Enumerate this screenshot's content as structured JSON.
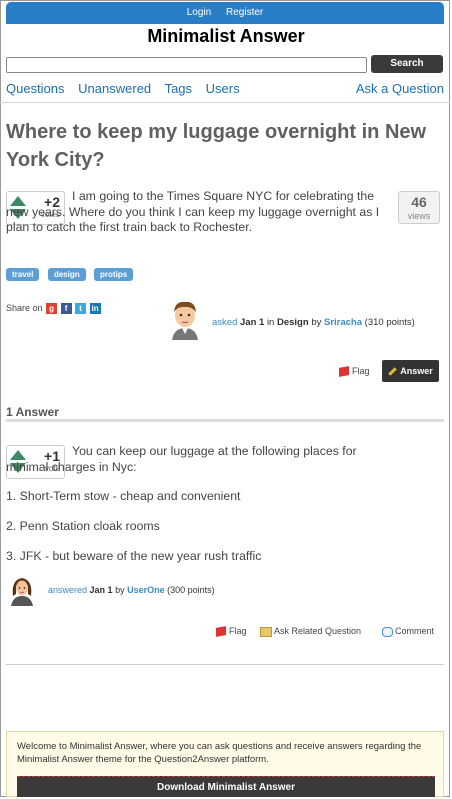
{
  "header": {
    "login": "Login",
    "register": "Register",
    "site_title": "Minimalist Answer",
    "search_button": "Search",
    "search_placeholder": ""
  },
  "nav": {
    "questions": "Questions",
    "unanswered": "Unanswered",
    "tags": "Tags",
    "users": "Users",
    "ask": "Ask a Question"
  },
  "question": {
    "title": "Where to keep my luggage overnight in New York City?",
    "votes": "+2",
    "votes_label": "votes",
    "views": "46",
    "views_label": "views",
    "body": "I am going to the Times Square NYC for celebrating the new years. Where do you think I can keep my luggage overnight as I plan to catch the first train back to Rochester.",
    "tags": [
      "travel",
      "design",
      "protips"
    ],
    "share_label": "Share on",
    "share_icons": [
      "google-plus-icon",
      "facebook-icon",
      "twitter-icon",
      "linkedin-icon"
    ],
    "meta": {
      "action": "asked",
      "date": "Jan 1",
      "in": "in",
      "category": "Design",
      "by": "by",
      "user": "Sriracha",
      "points": "(310 points)"
    },
    "flag": "Flag",
    "answer_button": "Answer"
  },
  "answers_header": "1 Answer",
  "answer": {
    "votes": "+1",
    "votes_label": "vote",
    "body": "You can keep our luggage at the following places for minimal charges in Nyc:",
    "items": [
      "1. Short-Term stow - cheap and convenient",
      "2. Penn Station cloak rooms",
      "3. JFK - but beware of the new year rush traffic"
    ],
    "meta": {
      "action": "answered",
      "date": "Jan 1",
      "by": "by",
      "user": "UserOne",
      "points": "(300 points)"
    },
    "flag": "Flag",
    "ask_related": "Ask Related Question",
    "comment": "Comment"
  },
  "welcome": {
    "text": "Welcome to Minimalist Answer, where you can ask questions and receive answers regarding the Minimalist Answer theme for the Question2Answer platform.",
    "download": "Download Minimalist Answer"
  },
  "colors": {
    "link": "#1a6fb0",
    "topbar": "#2a7ec6",
    "vote_arrow": "#3f8a66",
    "tag": "#5b9fd6",
    "dark_button": "#3a3a3a"
  }
}
